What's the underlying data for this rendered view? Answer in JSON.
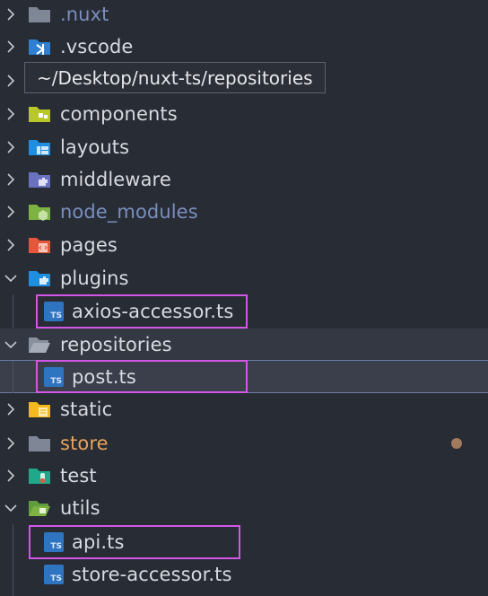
{
  "tooltip": {
    "path": "~/Desktop/nuxt-ts/repositories"
  },
  "tree": {
    "nuxt": {
      "label": ".nuxt",
      "color": "#7a8fbf"
    },
    "vscode": {
      "label": ".vscode"
    },
    "components": {
      "label": "components"
    },
    "layouts": {
      "label": "layouts"
    },
    "middleware": {
      "label": "middleware"
    },
    "node_modules": {
      "label": "node_modules",
      "color": "#7a8fbf"
    },
    "pages": {
      "label": "pages"
    },
    "plugins": {
      "label": "plugins",
      "children": [
        {
          "label": "axios-accessor.ts",
          "icon": "TS"
        }
      ]
    },
    "repositories": {
      "label": "repositories",
      "children": [
        {
          "label": "post.ts",
          "icon": "TS"
        }
      ]
    },
    "static": {
      "label": "static"
    },
    "store": {
      "label": "store",
      "color": "#e8a25c",
      "modified_dot_color": "#a27a5d"
    },
    "test": {
      "label": "test"
    },
    "utils": {
      "label": "utils",
      "children": [
        {
          "label": "api.ts",
          "icon": "TS"
        },
        {
          "label": "store-accessor.ts",
          "icon": "TS"
        }
      ]
    }
  },
  "colors": {
    "background": "#282c34",
    "selected_row": "#3a3f4b",
    "highlight_box": "#d257e6",
    "ts_icon": "#2f74c0"
  }
}
